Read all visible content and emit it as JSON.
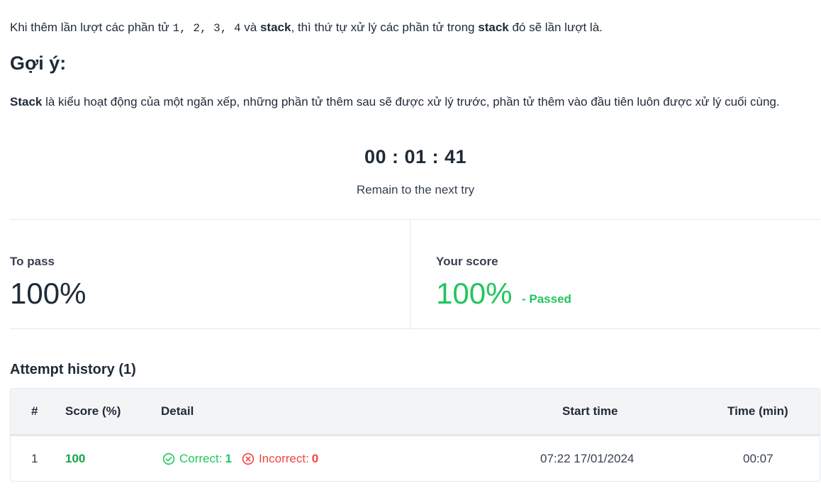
{
  "question": {
    "prefix": "Khi thêm lần lượt các phần tử ",
    "sequence": "1, 2, 3, 4",
    "middle_1": " và ",
    "stack_word_1": "stack",
    "middle_2": ", thì thứ tự xử lý các phần tử trong ",
    "stack_word_2": "stack",
    "suffix": " đó sẽ lần lượt là."
  },
  "hint": {
    "title": "Gợi ý:",
    "bold_word": "Stack",
    "body": " là kiểu hoạt động của một ngăn xếp, những phần tử thêm sau sẽ được xử lý trước, phần tử thêm vào đầu tiên luôn được xử lý cuối cùng."
  },
  "timer": {
    "value": "00 : 01 : 41",
    "caption": "Remain to the next try"
  },
  "scores": {
    "to_pass_label": "To pass",
    "to_pass_value": "100%",
    "your_score_label": "Your score",
    "your_score_value": "100%",
    "status": "- Passed"
  },
  "history": {
    "title": "Attempt history (1)",
    "headers": {
      "index": "#",
      "score": "Score (%)",
      "detail": "Detail",
      "start_time": "Start time",
      "duration": "Time (min)"
    },
    "rows": [
      {
        "index": "1",
        "score": "100",
        "correct_label": "Correct:",
        "correct_count": "1",
        "incorrect_label": "Incorrect:",
        "incorrect_count": "0",
        "start_time": "07:22 17/01/2024",
        "duration": "00:07"
      }
    ]
  },
  "colors": {
    "success": "#22c55e",
    "error": "#ef4444",
    "text": "#1f2a37",
    "header_bg": "#f3f4f6"
  },
  "icons": {
    "correct": "check-circle-icon",
    "incorrect": "x-circle-icon"
  }
}
